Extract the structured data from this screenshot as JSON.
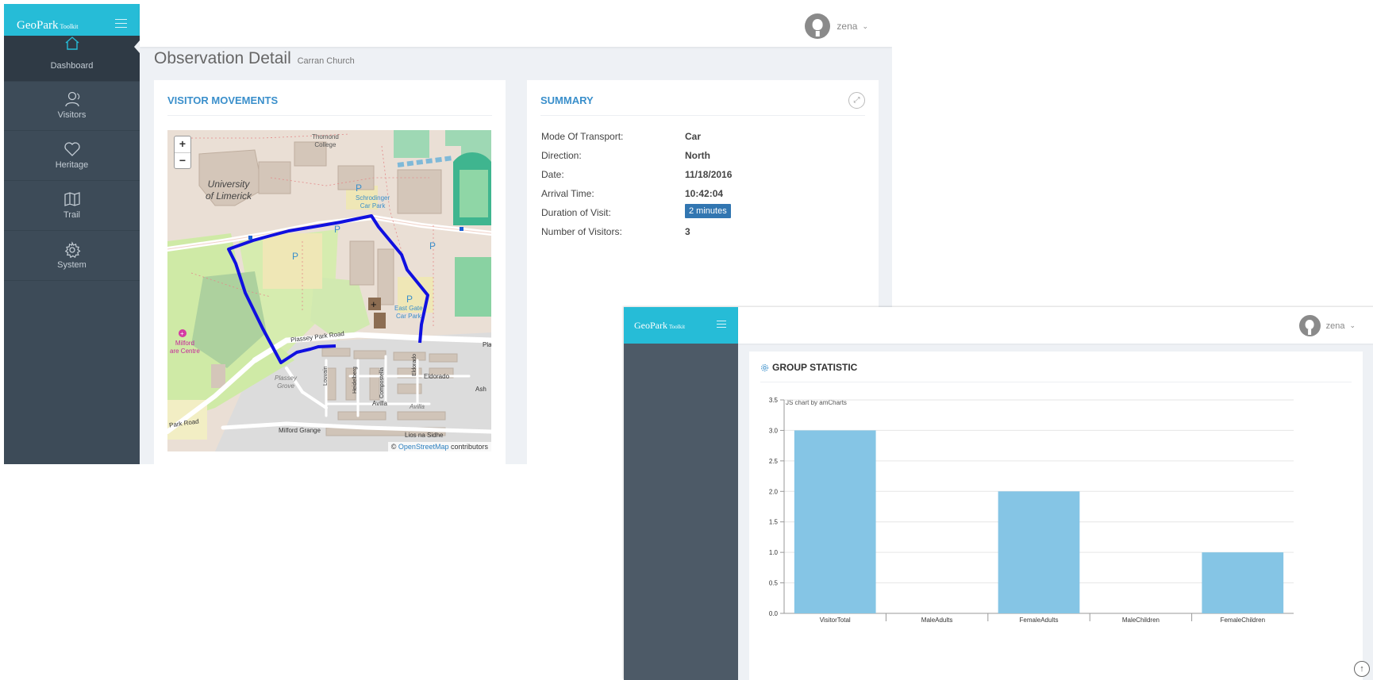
{
  "window1": {
    "brand": {
      "name": "GeoPark",
      "suffix": "Toolkit"
    },
    "user": {
      "name": "zena"
    },
    "sidebar": [
      {
        "label": "Dashboard",
        "icon": "home-icon",
        "active": true
      },
      {
        "label": "Visitors",
        "icon": "users-icon"
      },
      {
        "label": "Heritage",
        "icon": "heart-icon"
      },
      {
        "label": "Trail",
        "icon": "map-icon"
      },
      {
        "label": "System",
        "icon": "gear-icon"
      }
    ],
    "page_title": "Observation Detail",
    "page_subtitle": "Carran Church",
    "movements": {
      "title": "VISITOR MOVEMENTS",
      "zoom_in": "+",
      "zoom_out": "−",
      "attribution_prefix": "© ",
      "attribution_link": "OpenStreetMap",
      "attribution_suffix": " contributors",
      "labels": {
        "thomond": "Thomond",
        "college": "College",
        "university": "University",
        "of_limerick": "of Limerick",
        "schrodinger": "Schrodinger",
        "car_park": "Car Park",
        "east_gate": "East Gate",
        "car_park_2": "Car Park",
        "milford": "Milford",
        "care_centre": "are Centre",
        "plassey_park_road": "Plassey Park Road",
        "plassey_grove": "Plassey",
        "grove": "Grove",
        "louvain": "Louvain",
        "heidelberg": "Heidelberg",
        "compostella": "Compostella",
        "eldorado": "Eldorado",
        "eldorado2": "Eldorado",
        "avilla": "Avilla",
        "avilla2": "Avilla",
        "ash": "Ash",
        "park_road": "Park Road",
        "milford_grange": "Milford Grange",
        "lios_na_sidhe": "Lios na Sidhe",
        "pla": "Pla",
        "p": "P"
      }
    },
    "summary": {
      "title": "SUMMARY",
      "rows": [
        {
          "label": "Mode Of Transport:",
          "value": "Car"
        },
        {
          "label": "Direction:",
          "value": "North"
        },
        {
          "label": "Date:",
          "value": "11/18/2016"
        },
        {
          "label": "Arrival Time:",
          "value": "10:42:04"
        },
        {
          "label": "Duration of Visit:",
          "value": "2 minutes",
          "badge": true
        },
        {
          "label": "Number of Visitors:",
          "value": "3"
        }
      ]
    },
    "colors": {
      "brand": "#26bcd7",
      "sidebar": "#3d4b58",
      "accent": "#3a8fcb",
      "route": "#1010e0"
    }
  },
  "window2": {
    "brand": {
      "name": "GeoPark",
      "suffix": "Toolkit"
    },
    "user": {
      "name": "zena"
    },
    "panel_title": "GROUP STATISTIC",
    "credit": "JS chart by amCharts"
  },
  "chart_data": {
    "type": "bar",
    "title": "GROUP STATISTIC",
    "categories": [
      "VisitorTotal",
      "MaleAdults",
      "FemaleAdults",
      "MaleChildren",
      "FemaleChildren"
    ],
    "values": [
      3,
      0,
      2,
      0,
      1
    ],
    "ylim": [
      0,
      3.5
    ],
    "yticks": [
      "0.0",
      "0.5",
      "1.0",
      "1.5",
      "2.0",
      "2.5",
      "3.0",
      "3.5"
    ],
    "grid": true,
    "bar_color": "#85c5e5"
  }
}
